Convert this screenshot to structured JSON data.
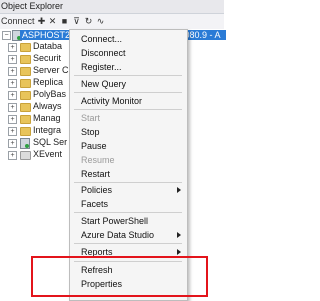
{
  "panel": {
    "title": "Object Explorer"
  },
  "toolbar": {
    "connect_label": "Connect",
    "connect_arrow_icon": "chevron-down-icon",
    "icons": [
      "connect-icon",
      "disconnect-icon",
      "filter-icon",
      "refresh-icon",
      "activity-icon"
    ]
  },
  "tree": {
    "server": "ASPHOST2",
    "server_suffix": ".2080.9 - A",
    "children": [
      {
        "label": "Databa"
      },
      {
        "label": "Securit"
      },
      {
        "label": "Server C"
      },
      {
        "label": "Replica"
      },
      {
        "label": "PolyBas"
      },
      {
        "label": "Always"
      },
      {
        "label": "Manag"
      },
      {
        "label": "Integra"
      },
      {
        "label": "SQL Ser"
      },
      {
        "label": "XEvent"
      }
    ]
  },
  "context_menu": {
    "connect": "Connect...",
    "disconnect": "Disconnect",
    "register": "Register...",
    "new_query": "New Query",
    "activity_monitor": "Activity Monitor",
    "start": "Start",
    "stop": "Stop",
    "pause": "Pause",
    "resume": "Resume",
    "restart": "Restart",
    "policies": "Policies",
    "facets": "Facets",
    "start_powershell": "Start PowerShell",
    "azure_data_studio": "Azure Data Studio",
    "reports": "Reports",
    "refresh": "Refresh",
    "properties": "Properties"
  },
  "colors": {
    "selection": "#2a7bd6",
    "highlight_box": "#e3141b"
  }
}
